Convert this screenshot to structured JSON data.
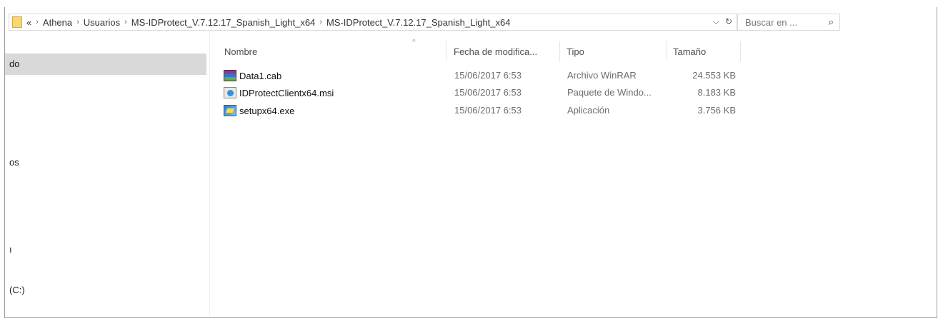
{
  "address": {
    "crumbs": [
      "Athena",
      "Usuarios",
      "MS-IDProtect_V.7.12.17_Spanish_Light_x64",
      "MS-IDProtect_V.7.12.17_Spanish_Light_x64"
    ],
    "overflow": "«",
    "dropdown": "⌵",
    "refresh": "↻"
  },
  "search": {
    "placeholder": "Buscar en ...",
    "icon": "search-icon"
  },
  "nav": {
    "items": [
      {
        "label": "do",
        "selected": true
      },
      {
        "label": "os"
      },
      {
        "label": "ı"
      },
      {
        "label": "(C:)"
      }
    ]
  },
  "columns": {
    "name": "Nombre",
    "date": "Fecha de modifica...",
    "type": "Tipo",
    "size": "Tamaño",
    "sort_indicator": "^"
  },
  "files": [
    {
      "name": "Data1.cab",
      "date": "15/06/2017 6:53",
      "type": "Archivo WinRAR",
      "size": "24.553 KB",
      "icon": "winrar-archive-icon"
    },
    {
      "name": "IDProtectClientx64.msi",
      "date": "15/06/2017 6:53",
      "type": "Paquete de Windo...",
      "size": "8.183 KB",
      "icon": "windows-installer-icon"
    },
    {
      "name": "setupx64.exe",
      "date": "15/06/2017 6:53",
      "type": "Aplicación",
      "size": "3.756 KB",
      "icon": "setup-application-icon"
    }
  ]
}
